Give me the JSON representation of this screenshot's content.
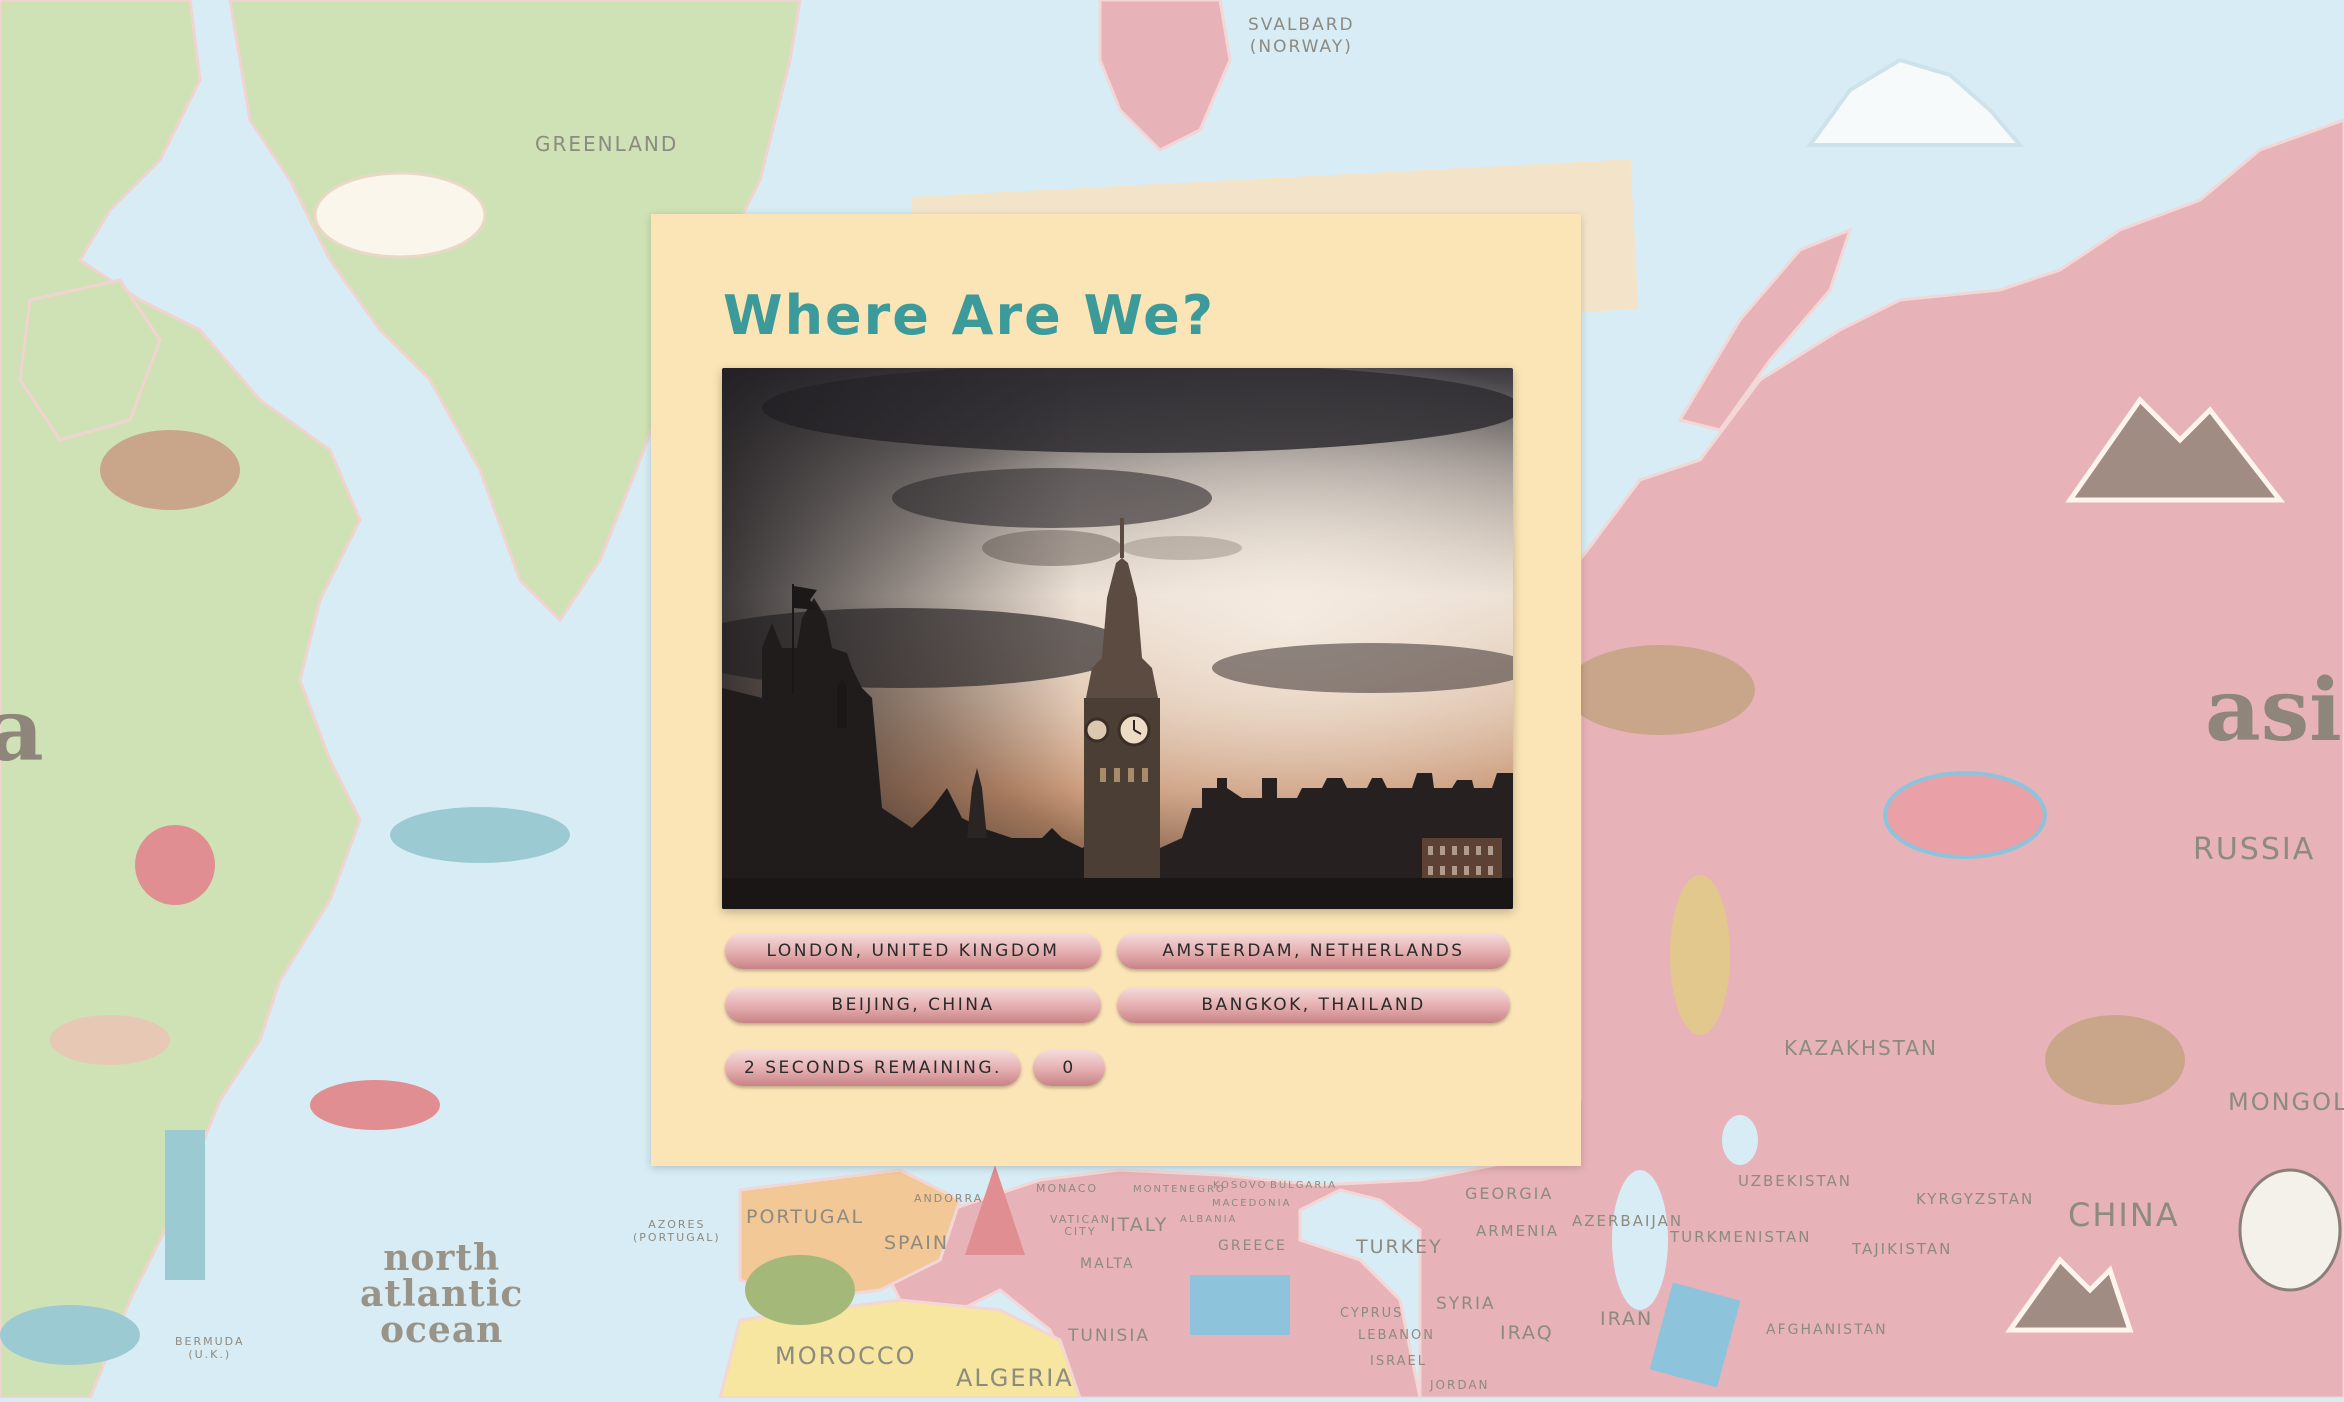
{
  "colors": {
    "ocean": "#d7ecf4",
    "americas": "#cfe2b5",
    "eurasia": "#e7b3b8",
    "africa": "#f6e6a0",
    "card": "#fbe5b6",
    "title": "#3c9b9a",
    "button_top": "#f5dcdc",
    "button_bottom": "#c88386"
  },
  "map": {
    "labels": {
      "svalbard": "SVALBARD\n(NORWAY)",
      "greenland": "GREENLAND",
      "russia": "RUSSIA",
      "kazakhstan": "KAZAKHSTAN",
      "mongolia": "MONGOL",
      "china": "CHINA",
      "asia": "asia",
      "america_fragment": "a",
      "north_atlantic": "north\natlantic\nocean",
      "azores": "AZORES\n(PORTUGAL)",
      "bermuda": "BERMUDA\n(U.K.)",
      "portugal": "PORTUGAL",
      "spain": "SPAIN",
      "andorra": "ANDORRA",
      "monaco": "MONACO",
      "vatican": "VATICAN\nCITY",
      "italy": "ITALY",
      "malta": "MALTA",
      "greece": "GREECE",
      "montenegro": "MONTENEGRO",
      "kosovo": "KOSOVO",
      "macedonia": "MACEDONIA",
      "bulgaria": "BULGARIA",
      "albania": "ALBANIA",
      "turkey": "TURKEY",
      "georgia": "GEORGIA",
      "armenia": "ARMENIA",
      "azerbaijan": "AZERBAIJAN",
      "uzbekistan": "UZBEKISTAN",
      "kyrgyzstan": "KYRGYZSTAN",
      "turkmenistan": "TURKMENISTAN",
      "tajikistan": "TAJIKISTAN",
      "cyprus": "CYPRUS",
      "lebanon": "LEBANON",
      "israel": "ISRAEL",
      "syria": "SYRIA",
      "iraq": "IRAQ",
      "iran": "IRAN",
      "afghanistan": "AFGHANISTAN",
      "jordan": "JORDAN",
      "tunisia": "TUNISIA",
      "morocco": "MOROCCO",
      "algeria": "ALGERIA"
    }
  },
  "quiz": {
    "title": "Where Are We?",
    "photo_subject": "big-ben-westminster-sunset",
    "answers": [
      "London, United Kingdom",
      "Amsterdam, Netherlands",
      "Beijing, China",
      "Bangkok, Thailand"
    ],
    "timer_text": "2 seconds remaining.",
    "score": "0"
  }
}
